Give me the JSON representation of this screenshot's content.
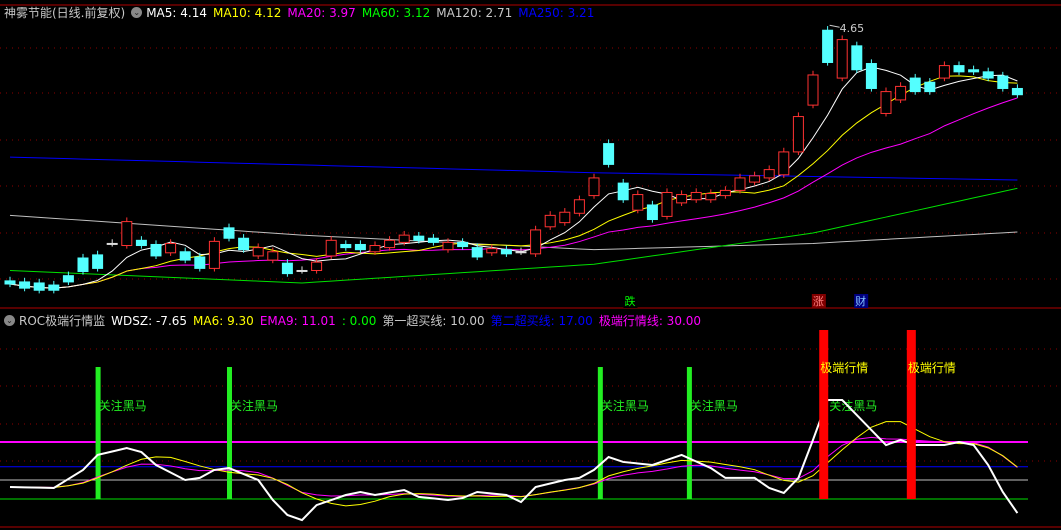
{
  "top_legend": {
    "title": "神雾节能(日线.前复权)",
    "ma5": "MA5: 4.14",
    "ma10": "MA10: 4.12",
    "ma20": "MA20: 3.97",
    "ma60": "MA60: 3.12",
    "ma120": "MA120: 2.71",
    "ma250": "MA250: 3.21"
  },
  "bottom_legend": {
    "title": "ROC极端行情监",
    "wdsz": "WDSZ: -7.65",
    "ma6": "MA6: 9.30",
    "ema9": "EMA9: 11.01",
    "zero": ": 0.00",
    "line1": "第一超买线: 10.00",
    "line2": "第二超买线: 17.00",
    "line3": "极端行情线: 30.00"
  },
  "colors": {
    "up": "#ff3232",
    "down": "#54ffff",
    "ma5": "#ffffff",
    "ma10": "#ffff00",
    "ma20": "#ff00ff",
    "ma60": "#00e000",
    "ma120": "#c0c0c0",
    "ma250": "#0000ff",
    "grid": "#8b0000"
  },
  "high_label": "4.65",
  "marks": {
    "die": "跌",
    "zhang": "涨",
    "cai": "财"
  },
  "signal_labels": {
    "heima": "关注黑马",
    "jiduan": "极端行情"
  },
  "candles": [
    [
      2.24,
      2.21
    ],
    [
      2.23,
      2.17
    ],
    [
      2.22,
      2.15
    ],
    [
      2.2,
      2.15
    ],
    [
      2.29,
      2.23
    ],
    [
      2.46,
      2.33
    ],
    [
      2.49,
      2.36
    ],
    [
      2.6,
      2.6
    ],
    [
      2.58,
      2.81
    ],
    [
      2.63,
      2.58
    ],
    [
      2.59,
      2.48
    ],
    [
      2.51,
      2.6
    ],
    [
      2.52,
      2.44
    ],
    [
      2.47,
      2.36
    ],
    [
      2.36,
      2.62
    ],
    [
      2.75,
      2.65
    ],
    [
      2.65,
      2.54
    ],
    [
      2.48,
      2.56
    ],
    [
      2.44,
      2.52
    ],
    [
      2.41,
      2.31
    ],
    [
      2.34,
      2.34
    ],
    [
      2.34,
      2.42
    ],
    [
      2.48,
      2.63
    ],
    [
      2.59,
      2.56
    ],
    [
      2.59,
      2.54
    ],
    [
      2.52,
      2.58
    ],
    [
      2.56,
      2.63
    ],
    [
      2.61,
      2.68
    ],
    [
      2.67,
      2.63
    ],
    [
      2.65,
      2.61
    ],
    [
      2.54,
      2.61
    ],
    [
      2.61,
      2.57
    ],
    [
      2.56,
      2.47
    ],
    [
      2.51,
      2.55
    ],
    [
      2.54,
      2.5
    ],
    [
      2.52,
      2.52
    ],
    [
      2.5,
      2.73
    ],
    [
      2.76,
      2.87
    ],
    [
      2.8,
      2.9
    ],
    [
      2.89,
      3.02
    ],
    [
      3.06,
      3.23
    ],
    [
      3.56,
      3.36
    ],
    [
      3.18,
      3.02
    ],
    [
      2.92,
      3.07
    ],
    [
      2.97,
      2.83
    ],
    [
      2.86,
      3.09
    ],
    [
      2.99,
      3.07
    ],
    [
      3.02,
      3.09
    ],
    [
      3.02,
      3.08
    ],
    [
      3.06,
      3.11
    ],
    [
      3.11,
      3.23
    ],
    [
      3.19,
      3.25
    ],
    [
      3.23,
      3.31
    ],
    [
      3.26,
      3.48
    ],
    [
      3.48,
      3.82
    ],
    [
      3.93,
      4.22
    ],
    [
      4.65,
      4.34
    ],
    [
      4.19,
      4.56
    ],
    [
      4.5,
      4.27
    ],
    [
      4.33,
      4.09
    ],
    [
      3.85,
      4.06
    ],
    [
      3.98,
      4.11
    ],
    [
      4.19,
      4.06
    ],
    [
      4.15,
      4.06
    ],
    [
      4.19,
      4.31
    ],
    [
      4.31,
      4.25
    ],
    [
      4.27,
      4.25
    ],
    [
      4.25,
      4.19
    ],
    [
      4.21,
      4.09
    ],
    [
      4.09,
      4.03
    ]
  ],
  "ma_long": {
    "ma60": [
      [
        0,
        2.34
      ],
      [
        20,
        2.22
      ],
      [
        40,
        2.4
      ],
      [
        55,
        2.7
      ],
      [
        69,
        3.13
      ]
    ],
    "ma120": [
      [
        0,
        2.87
      ],
      [
        20,
        2.68
      ],
      [
        40,
        2.54
      ],
      [
        55,
        2.6
      ],
      [
        69,
        2.71
      ]
    ],
    "ma250": [
      [
        0,
        3.43
      ],
      [
        40,
        3.28
      ],
      [
        69,
        3.21
      ]
    ]
  },
  "roc": [
    [
      0,
      6.3
    ],
    [
      3,
      5.8
    ],
    [
      5,
      15.3
    ],
    [
      6,
      23.2
    ],
    [
      8,
      26.8
    ],
    [
      9,
      24.7
    ],
    [
      10,
      17.9
    ],
    [
      12,
      10
    ],
    [
      13,
      11.1
    ],
    [
      14,
      15.3
    ],
    [
      15,
      16.3
    ],
    [
      17,
      10
    ],
    [
      18,
      -0.5
    ],
    [
      19,
      -8.4
    ],
    [
      20,
      -11.1
    ],
    [
      21,
      -3.2
    ],
    [
      23,
      2.1
    ],
    [
      24,
      3.7
    ],
    [
      25,
      2.1
    ],
    [
      27,
      4.7
    ],
    [
      28,
      1.1
    ],
    [
      30,
      -0.5
    ],
    [
      31,
      0.5
    ],
    [
      32,
      3.7
    ],
    [
      34,
      2.1
    ],
    [
      35,
      -1.6
    ],
    [
      36,
      6.3
    ],
    [
      38,
      10
    ],
    [
      39,
      11.1
    ],
    [
      40,
      15.3
    ],
    [
      41,
      22.1
    ],
    [
      42,
      19.5
    ],
    [
      44,
      17.9
    ],
    [
      46,
      23.2
    ],
    [
      48,
      16.3
    ],
    [
      49,
      11.1
    ],
    [
      51,
      11.1
    ],
    [
      52,
      5.8
    ],
    [
      53,
      3.2
    ],
    [
      54,
      11.1
    ],
    [
      55,
      31.1
    ],
    [
      56,
      52.1
    ],
    [
      57,
      52.1
    ],
    [
      58,
      44.2
    ],
    [
      59,
      36.3
    ],
    [
      60,
      28.4
    ],
    [
      61,
      31.1
    ],
    [
      62,
      28.4
    ],
    [
      64,
      28.4
    ],
    [
      65,
      30
    ],
    [
      66,
      28.4
    ],
    [
      67,
      17.9
    ],
    [
      68,
      3.7
    ],
    [
      69,
      -7.4
    ]
  ],
  "thresholds": {
    "extreme": 30,
    "second": 17,
    "first": 10,
    "zero": 0
  },
  "signals": {
    "heima_bars": [
      6,
      15,
      40.4,
      46.5
    ],
    "jiduan_bars": [
      55.7,
      61.7
    ]
  }
}
